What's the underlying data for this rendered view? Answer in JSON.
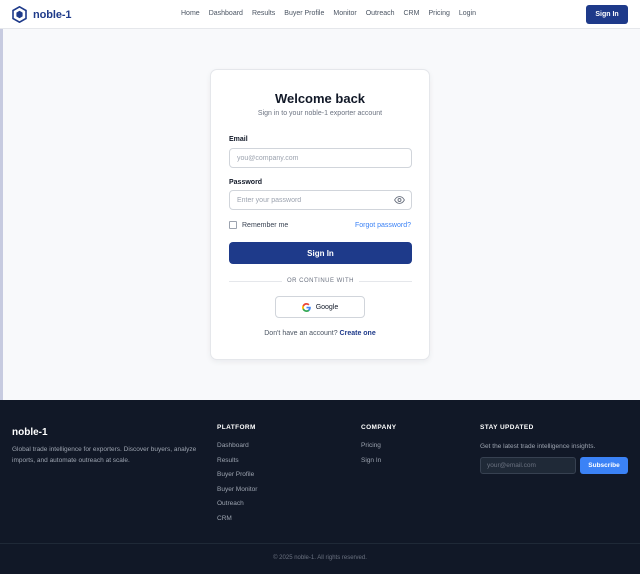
{
  "nav": {
    "brand": "noble-1",
    "links": [
      "Home",
      "Dashboard",
      "Results",
      "Buyer Profile",
      "Monitor",
      "Outreach",
      "CRM",
      "Pricing",
      "Login"
    ],
    "signin_label": "Sign In",
    "icon": "hexagon-logo-icon",
    "brand_color": "#1e3a8a"
  },
  "login": {
    "title": "Welcome back",
    "subtitle": "Sign in to your noble-1 exporter account",
    "email_label": "Email",
    "email_placeholder": "you@company.com",
    "password_label": "Password",
    "password_placeholder": "Enter your password",
    "password_toggle_icon": "eye-icon",
    "remember_label": "Remember me",
    "forgot_label": "Forgot password?",
    "submit_label": "Sign In",
    "divider_label": "OR CONTINUE WITH",
    "google_label": "Google",
    "signup_prompt": "Don't have an account?",
    "signup_link": "Create one"
  },
  "footer": {
    "brand": "noble-1",
    "description": "Global trade intelligence for exporters. Discover buyers, analyze imports, and automate outreach at scale.",
    "platform_heading": "PLATFORM",
    "platform_links": [
      "Dashboard",
      "Results",
      "Buyer Profile",
      "Buyer Monitor",
      "Outreach",
      "CRM"
    ],
    "company_heading": "COMPANY",
    "company_links": [
      "Pricing",
      "Sign In"
    ],
    "newsletter_heading": "STAY UPDATED",
    "newsletter_text": "Get the latest trade intelligence insights.",
    "newsletter_placeholder": "your@email.com",
    "subscribe_label": "Subscribe",
    "copyright": "© 2025 noble-1. All rights reserved."
  },
  "colors": {
    "primary": "#1e3a8a",
    "accent": "#3b82f6",
    "footer_bg": "#111827"
  }
}
